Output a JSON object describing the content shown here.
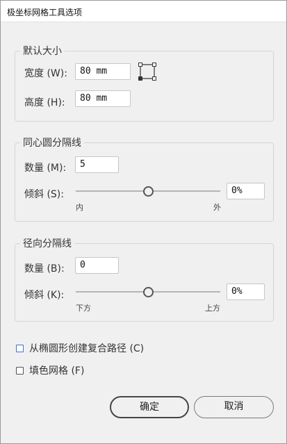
{
  "window": {
    "title": "极坐标网格工具选项"
  },
  "default_size": {
    "legend": "默认大小",
    "width_label": "宽度 (W):",
    "width_value": "80 mm",
    "height_label": "高度 (H):",
    "height_value": "80 mm",
    "reference_point_icon": "reference-point-icon"
  },
  "concentric": {
    "legend": "同心圆分隔线",
    "count_label": "数量 (M):",
    "count_value": "5",
    "skew_label": "倾斜 (S):",
    "skew_value": "0%",
    "slider_level": 0.5,
    "min_label": "内",
    "max_label": "外"
  },
  "radial": {
    "legend": "径向分隔线",
    "count_label": "数量 (B):",
    "count_value": "0",
    "skew_label": "倾斜 (K):",
    "skew_value": "0%",
    "slider_level": 0.5,
    "min_label": "下方",
    "max_label": "上方"
  },
  "options": {
    "compound_path_label": "从椭圆形创建复合路径 (C)",
    "compound_path_checked": false,
    "fill_grid_label": "填色网格 (F)",
    "fill_grid_checked": false
  },
  "buttons": {
    "ok": "确定",
    "cancel": "取消"
  },
  "colors": {
    "focus_outline": "#3f6ed8",
    "dialog_bg": "#f0f0f0"
  }
}
